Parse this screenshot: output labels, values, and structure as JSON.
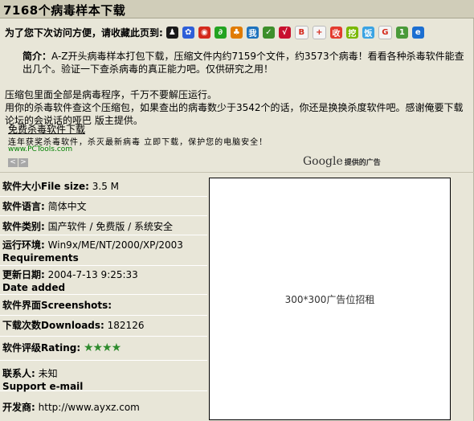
{
  "title": "7168个病毒样本下载",
  "bookmark": {
    "label": "为了您下次访问方便，请收藏此页到:",
    "icons": [
      {
        "name": "penguin-icon",
        "color": "#1a1a1a",
        "glyph": "♟"
      },
      {
        "name": "paw-icon",
        "color": "#2e5fd8",
        "glyph": "✿"
      },
      {
        "name": "weibo-icon",
        "color": "#d42a1c",
        "glyph": "◉"
      },
      {
        "name": "swirl-icon",
        "color": "#23a321",
        "glyph": "∂"
      },
      {
        "name": "flame-icon",
        "color": "#e07b00",
        "glyph": "♣"
      },
      {
        "name": "wo-icon",
        "color": "#1e73be",
        "glyph": "我"
      },
      {
        "name": "note-icon",
        "color": "#3d8f2b",
        "glyph": "✓"
      },
      {
        "name": "bird-icon",
        "color": "#c8102e",
        "glyph": "√"
      },
      {
        "name": "b-icon",
        "color": "#f5f5f5",
        "glyph": "B"
      },
      {
        "name": "plus-icon",
        "color": "#f5f5f5",
        "glyph": "+"
      },
      {
        "name": "shou-icon",
        "color": "#e33b2e",
        "glyph": "收"
      },
      {
        "name": "wa-icon",
        "color": "#7ab800",
        "glyph": "挖"
      },
      {
        "name": "fan-icon",
        "color": "#3aa3e3",
        "glyph": "饭"
      },
      {
        "name": "google-icon",
        "color": "#f5f5f5",
        "glyph": "G"
      },
      {
        "name": "one-icon",
        "color": "#4a9a3a",
        "glyph": "1"
      },
      {
        "name": "ie-icon",
        "color": "#1c6fd1",
        "glyph": "e"
      }
    ]
  },
  "description": {
    "label": "简介：",
    "line1": "A-Z开头病毒样本打包下载，压缩文件内约7159个文件，约3573个病毒！看看各种杀毒软件能查出几个。验证一下查杀病毒的真正能力吧。仅供研究之用！",
    "line2": "压缩包里面全部是病毒程序，千万不要解压运行。",
    "line3": "用你的杀毒软件查这个压缩包，如果查出的病毒数少于3542个的话，你还是换换杀度软件吧。感谢俺要下载论坛的会说话的哑巴 版主提供。"
  },
  "ad": {
    "link": "免费杀毒软件下载",
    "desc": "连年获奖杀毒软件，杀灭最新病毒 立即下载，保护您的电脑安全！",
    "url": "www.PCTools.com",
    "prev": "<",
    "next": ">",
    "google_brand": "Google",
    "google_suffix": "提供的广告"
  },
  "info": {
    "size_label": "软件大小File size:",
    "size_value": "3.5 M",
    "lang_label": "软件语言:",
    "lang_value": "简体中文",
    "type_label": "软件类别:",
    "type_value": "国产软件 / 免费版 / 系统安全",
    "env_label": "运行环境:",
    "env_value": "Win9x/ME/NT/2000/XP/2003",
    "env_label2": "Requirements",
    "date_label": "更新日期:",
    "date_value": "2004-7-13 9:25:33",
    "date_label2": "Date added",
    "screenshot_label": "软件界面Screenshots:",
    "downloads_label": "下载次数Downloads:",
    "downloads_value": "182126",
    "rating_label": "软件评级Rating:",
    "rating_stars": "★★★★",
    "rating_value": 4,
    "contact_label": "联系人:",
    "contact_value": "未知",
    "support_label": "Support e-mail",
    "dev_label": "开发商:",
    "dev_value": "http://www.ayxz.com"
  },
  "adbox": {
    "text": "300*300广告位招租"
  }
}
